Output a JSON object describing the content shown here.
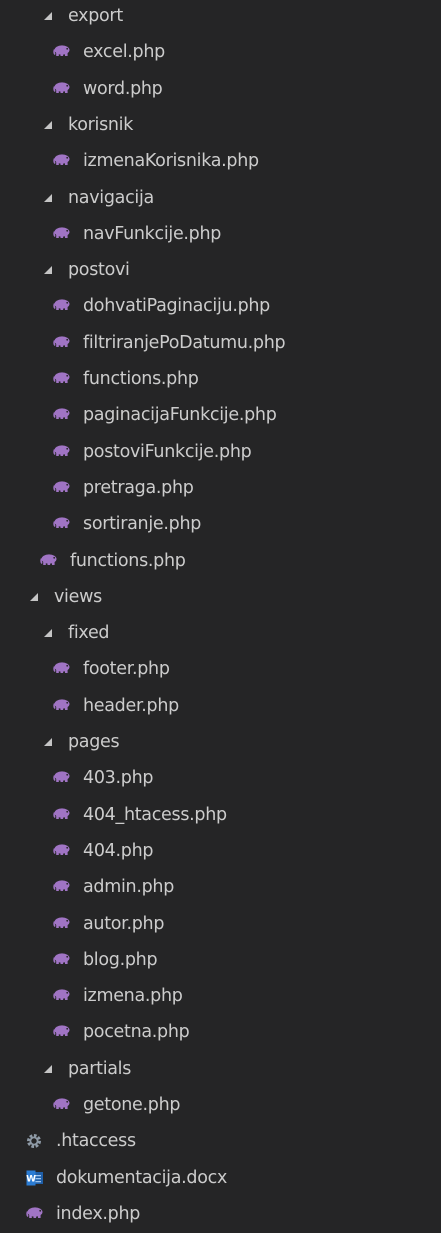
{
  "explorer": {
    "items": [
      {
        "label": "export",
        "kind": "folder",
        "depth": 2
      },
      {
        "label": "excel.php",
        "kind": "php",
        "depth": 3
      },
      {
        "label": "word.php",
        "kind": "php",
        "depth": 3
      },
      {
        "label": "korisnik",
        "kind": "folder",
        "depth": 2
      },
      {
        "label": "izmenaKorisnika.php",
        "kind": "php",
        "depth": 3
      },
      {
        "label": "navigacija",
        "kind": "folder",
        "depth": 2
      },
      {
        "label": "navFunkcije.php",
        "kind": "php",
        "depth": 3
      },
      {
        "label": "postovi",
        "kind": "folder",
        "depth": 2
      },
      {
        "label": "dohvatiPaginaciju.php",
        "kind": "php",
        "depth": 3
      },
      {
        "label": "filtriranjePoDatumu.php",
        "kind": "php",
        "depth": 3
      },
      {
        "label": "functions.php",
        "kind": "php",
        "depth": 3
      },
      {
        "label": "paginacijaFunkcije.php",
        "kind": "php",
        "depth": 3
      },
      {
        "label": "postoviFunkcije.php",
        "kind": "php",
        "depth": 3
      },
      {
        "label": "pretraga.php",
        "kind": "php",
        "depth": 3
      },
      {
        "label": "sortiranje.php",
        "kind": "php",
        "depth": 3
      },
      {
        "label": "functions.php",
        "kind": "php",
        "depth": 2
      },
      {
        "label": "views",
        "kind": "folder",
        "depth": 1
      },
      {
        "label": "fixed",
        "kind": "folder",
        "depth": 2
      },
      {
        "label": "footer.php",
        "kind": "php",
        "depth": 3
      },
      {
        "label": "header.php",
        "kind": "php",
        "depth": 3
      },
      {
        "label": "pages",
        "kind": "folder",
        "depth": 2
      },
      {
        "label": "403.php",
        "kind": "php",
        "depth": 3
      },
      {
        "label": "404_htacess.php",
        "kind": "php",
        "depth": 3
      },
      {
        "label": "404.php",
        "kind": "php",
        "depth": 3
      },
      {
        "label": "admin.php",
        "kind": "php",
        "depth": 3
      },
      {
        "label": "autor.php",
        "kind": "php",
        "depth": 3
      },
      {
        "label": "blog.php",
        "kind": "php",
        "depth": 3
      },
      {
        "label": "izmena.php",
        "kind": "php",
        "depth": 3
      },
      {
        "label": "pocetna.php",
        "kind": "php",
        "depth": 3
      },
      {
        "label": "partials",
        "kind": "folder",
        "depth": 2
      },
      {
        "label": "getone.php",
        "kind": "php",
        "depth": 3
      },
      {
        "label": ".htaccess",
        "kind": "config",
        "depth": 1
      },
      {
        "label": "dokumentacija.docx",
        "kind": "word",
        "depth": 1
      },
      {
        "label": "index.php",
        "kind": "php",
        "depth": 1
      }
    ]
  },
  "colors": {
    "background": "#252526",
    "text": "#cccccc",
    "php_icon": "#a074c4",
    "config_icon": "#8e9aa6",
    "word_icon": "#2b7cd3"
  },
  "icons": {
    "folder": "expanded-chevron-icon",
    "php": "php-elephant-icon",
    "config": "gear-icon",
    "word": "word-document-icon"
  }
}
